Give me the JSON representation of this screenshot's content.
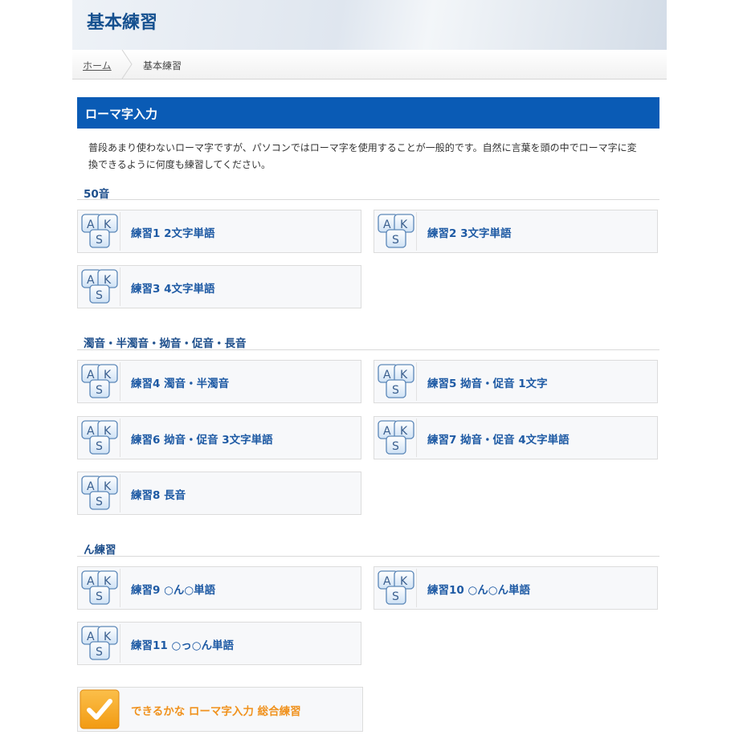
{
  "header": {
    "title": "基本練習"
  },
  "breadcrumb": {
    "home": "ホーム",
    "current": "基本練習"
  },
  "section": {
    "title": "ローマ字入力",
    "description": "普段あまり使わないローマ字ですが、パソコンではローマ字を使用することが一般的です。自然に言葉を頭の中でローマ字に変換できるように何度も練習してください。"
  },
  "groups": [
    {
      "title": "50音",
      "items": [
        {
          "label": "練習1 2文字単語",
          "icon": "aks-keys-icon"
        },
        {
          "label": "練習2 3文字単語",
          "icon": "aks-keys-icon"
        },
        {
          "label": "練習3 4文字単語",
          "icon": "aks-keys-icon"
        }
      ]
    },
    {
      "title": "濁音・半濁音・拗音・促音・長音",
      "items": [
        {
          "label": "練習4 濁音・半濁音",
          "icon": "aks-keys-icon"
        },
        {
          "label": "練習5 拗音・促音 1文字",
          "icon": "aks-keys-icon"
        },
        {
          "label": "練習6 拗音・促音 3文字単語",
          "icon": "aks-keys-icon"
        },
        {
          "label": "練習7 拗音・促音 4文字単語",
          "icon": "aks-keys-icon"
        },
        {
          "label": "練習8 長音",
          "icon": "aks-keys-icon"
        }
      ]
    },
    {
      "title": "ん練習",
      "items": [
        {
          "label": "練習9 ○ん○単語",
          "icon": "aks-keys-icon"
        },
        {
          "label": "練習10 ○ん○ん単語",
          "icon": "aks-keys-icon"
        },
        {
          "label": "練習11 ○っ○ん単語",
          "icon": "aks-keys-icon"
        }
      ]
    }
  ],
  "final": {
    "label": "できるかな ローマ字入力 総合練習",
    "icon": "checkmark-icon"
  },
  "colors": {
    "accent": "#0a5bb5",
    "link": "#1e5aa4",
    "final_text": "#f0921e",
    "final_icon": "#f5a623"
  }
}
